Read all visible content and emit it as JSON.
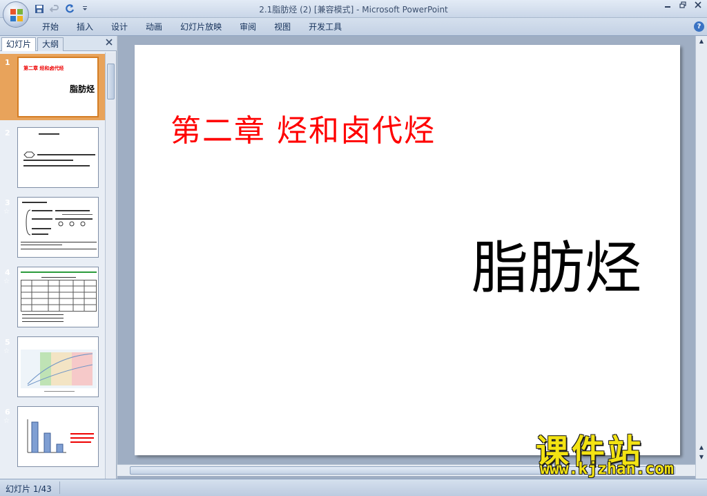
{
  "window": {
    "title": "2.1脂肪烃 (2) [兼容模式] - Microsoft PowerPoint"
  },
  "ribbon": {
    "tabs": [
      "开始",
      "插入",
      "设计",
      "动画",
      "幻灯片放映",
      "审阅",
      "视图",
      "开发工具"
    ]
  },
  "left_panel": {
    "tab_slides": "幻灯片",
    "tab_outline": "大纲",
    "close_icon": "close-icon",
    "thumbnails": [
      {
        "number": "1",
        "selected": true,
        "has_animation": false,
        "title": "第二章  烃和卤代烃",
        "subtitle": "脂肪烃"
      },
      {
        "number": "2",
        "selected": false,
        "has_animation": false
      },
      {
        "number": "3",
        "selected": false,
        "has_animation": true
      },
      {
        "number": "4",
        "selected": false,
        "has_animation": true
      },
      {
        "number": "5",
        "selected": false,
        "has_animation": true
      },
      {
        "number": "6",
        "selected": false,
        "has_animation": true
      }
    ]
  },
  "slide": {
    "title": "第二章  烃和卤代烃",
    "subtitle": "脂肪烃",
    "title_color": "#ff0000",
    "subtitle_color": "#000000"
  },
  "status_bar": {
    "slide_info": "幻灯片 1/43"
  },
  "watermark": {
    "big_text": "课件站",
    "url_text": "www.kjzhan.com",
    "color": "#f3e312"
  },
  "colors": {
    "accent": "#d47d24",
    "chrome": "#c3d1e4"
  }
}
